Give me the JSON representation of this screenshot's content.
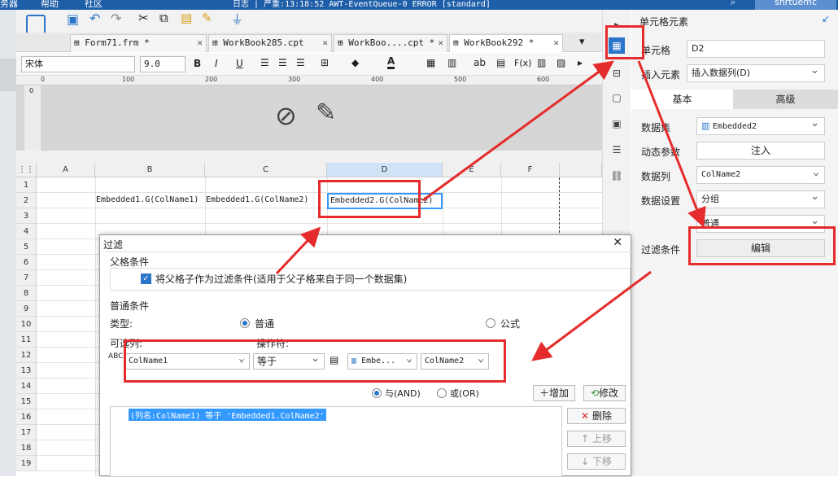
{
  "title_bar": {
    "left_text": "务器",
    "help": "帮助",
    "community": "社区",
    "log": "日志 | 严重:13:18:52 AWT-EventQueue-0 ERROR [standard]",
    "user": "shrtuemc"
  },
  "tabs": [
    {
      "label": "Form71.frm *",
      "close": "✕"
    },
    {
      "label": "WorkBook285.cpt",
      "close": "✕"
    },
    {
      "label": "WorkBoo....cpt *",
      "close": "✕"
    },
    {
      "label": "WorkBook292 *",
      "close": "✕"
    }
  ],
  "format_bar": {
    "font": "宋体",
    "size": "9.0",
    "bold": "B",
    "italic": "I",
    "underline": "U",
    "text_color": "A",
    "ab": "ab",
    "fx": "F(x)"
  },
  "ruler": {
    "marks": [
      "0",
      "100",
      "200",
      "300",
      "400",
      "500",
      "600"
    ],
    "vmark": "0"
  },
  "grid": {
    "columns": [
      "A",
      "B",
      "C",
      "D",
      "E",
      "F"
    ],
    "rows": [
      "1",
      "2",
      "3",
      "4",
      "5",
      "6",
      "7",
      "8",
      "9",
      "10",
      "11",
      "12",
      "13",
      "14",
      "15",
      "16",
      "17",
      "18",
      "19"
    ],
    "cells": {
      "b2": "Embedded1.G(ColName1)",
      "c2": "Embedded1.G(ColName2)",
      "d2": "Embedded2.G(ColName2)"
    }
  },
  "panel": {
    "title": "单元格元素",
    "cell_label": "单元格",
    "cell_value": "D2",
    "insert_label": "插入元素",
    "insert_value": "插入数据列(D)",
    "tab_basic": "基本",
    "tab_advanced": "高级",
    "dataset_label": "数据集",
    "dataset_value": "Embedded2",
    "param_label": "动态参数",
    "param_button": "注入",
    "column_label": "数据列",
    "column_value": "ColName2",
    "setting_label": "数据设置",
    "setting_value": "分组",
    "setting_sub": "普通",
    "filter_label": "过滤条件",
    "filter_button": "编辑"
  },
  "dialog": {
    "title": "过滤",
    "close": "✕",
    "parent_section": "父格条件",
    "parent_checkbox": "将父格子作为过滤条件(适用于父子格来自于同一个数据集)",
    "normal_section": "普通条件",
    "type_label": "类型:",
    "type_normal": "普通",
    "type_formula": "公式",
    "column_label": "可选列:",
    "operator_label": "操作符:",
    "column_value": "ColName1",
    "operator_value": "等于",
    "dataset_value": "Embe...",
    "target_column": "ColName2",
    "and_label": "与(AND)",
    "or_label": "或(OR)",
    "add_button": "增加",
    "modify_button": "修改",
    "delete_button": "删除",
    "up_button": "上移",
    "down_button": "下移",
    "condition": "(列名:ColName1) 等于 'Embedded1.ColName2'"
  },
  "colors": {
    "accent": "#2a74c9",
    "annotation": "#e52b2b",
    "selection": "#3399ff"
  }
}
